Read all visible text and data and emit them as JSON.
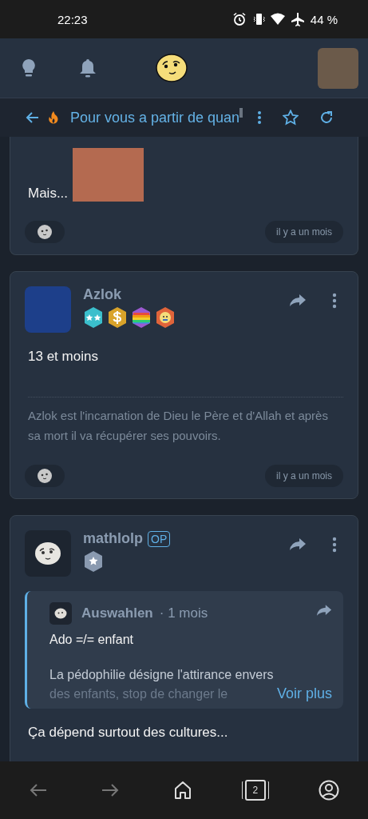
{
  "status_bar": {
    "time": "22:23",
    "battery": "44 %"
  },
  "subheader": {
    "title": "Pour vous a partir de quan"
  },
  "posts": [
    {
      "kind": "partial",
      "text": "Mais...",
      "time": "il y a un mois"
    },
    {
      "kind": "full",
      "author": "Azlok",
      "badges": [
        {
          "kind": "stars",
          "color": "#3bbfcc"
        },
        {
          "kind": "dollar",
          "color": "#d9a32a"
        },
        {
          "kind": "rainbow",
          "color": "#9b59d0"
        },
        {
          "kind": "face",
          "color": "#e0643a"
        }
      ],
      "text": "13 et moins",
      "signature": "Azlok est l'incarnation de Dieu le Père et d'Allah et après sa mort il va récupérer ses pouvoirs.",
      "time": "il y a un mois"
    },
    {
      "kind": "quote",
      "author": "mathlolp",
      "op": true,
      "op_label": "OP",
      "badges": [
        {
          "kind": "star",
          "color": "#8a9ab0"
        }
      ],
      "quote": {
        "author": "Auswahlen",
        "age": "· 1 mois",
        "lines": [
          "Ado =/= enfant",
          "La pédophilie désigne l'attirance envers"
        ],
        "faded": "des enfants, stop de changer le",
        "more": "Voir plus"
      },
      "text": "Ça dépend surtout des cultures..."
    }
  ],
  "bottom_nav": {
    "tabs_count": "2"
  }
}
